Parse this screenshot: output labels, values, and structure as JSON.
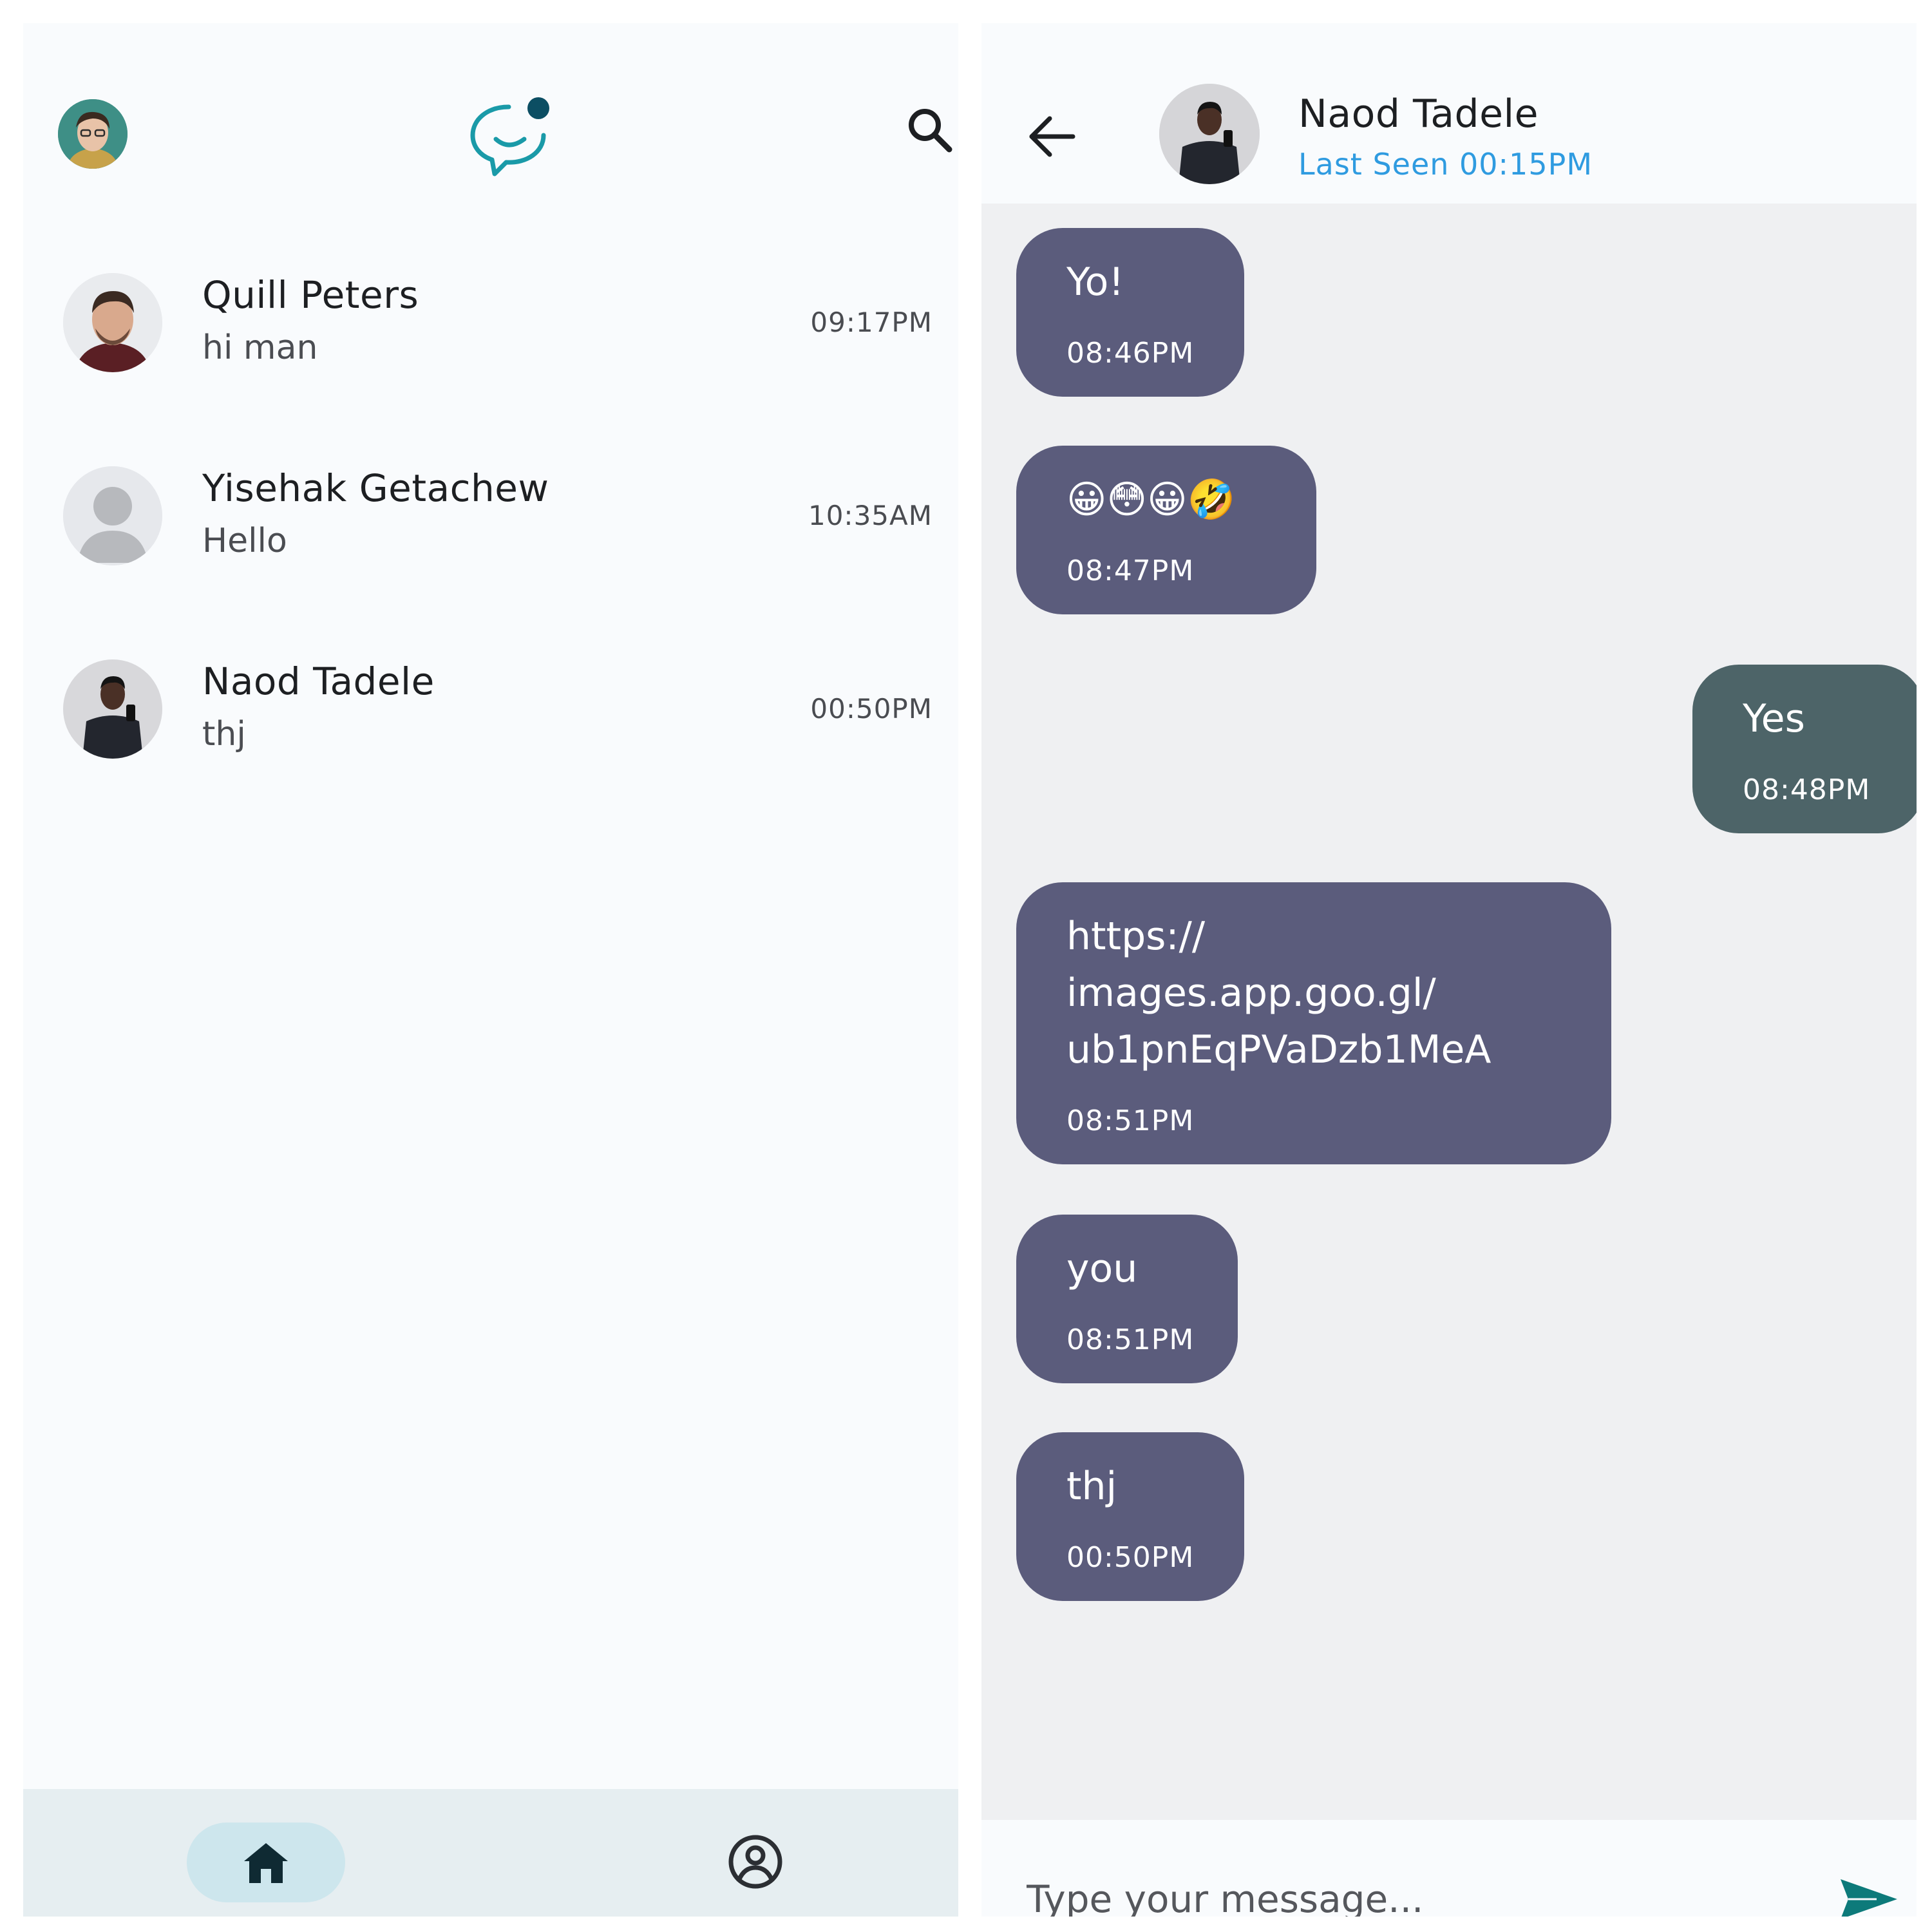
{
  "colors": {
    "accent": "#1a9aa8",
    "bubble_in": "#5b5c7c",
    "bubble_out": "#4d6468",
    "status": "#2f9be0",
    "send": "#0d7a7a"
  },
  "sidebar": {
    "icons": [
      "avatar",
      "chat-logo-icon",
      "search-icon"
    ]
  },
  "chats": [
    {
      "name": "Quill Peters",
      "preview": "hi man",
      "time": "09:17PM"
    },
    {
      "name": "Yisehak Getachew",
      "preview": "Hello",
      "time": "10:35AM"
    },
    {
      "name": "Naod Tadele",
      "preview": "thj",
      "time": "00:50PM"
    }
  ],
  "bottom_nav": {
    "icons": [
      "home-icon",
      "profile-icon"
    ]
  },
  "conversation": {
    "contact_name": "Naod Tadele",
    "status": "Last Seen 00:15PM",
    "messages": [
      {
        "text": "Yo!",
        "time": "08:46PM",
        "direction": "in"
      },
      {
        "text": "😀😳😀🤣",
        "time": "08:47PM",
        "direction": "in"
      },
      {
        "text": "Yes",
        "time": "08:48PM",
        "direction": "out"
      },
      {
        "text": "https://\nimages.app.goo.gl/\nub1pnEqPVaDzb1MeA",
        "time": "08:51PM",
        "direction": "in"
      },
      {
        "text": "you",
        "time": "08:51PM",
        "direction": "in"
      },
      {
        "text": "thj",
        "time": "00:50PM",
        "direction": "in"
      }
    ],
    "composer_placeholder": "Type your message..."
  }
}
